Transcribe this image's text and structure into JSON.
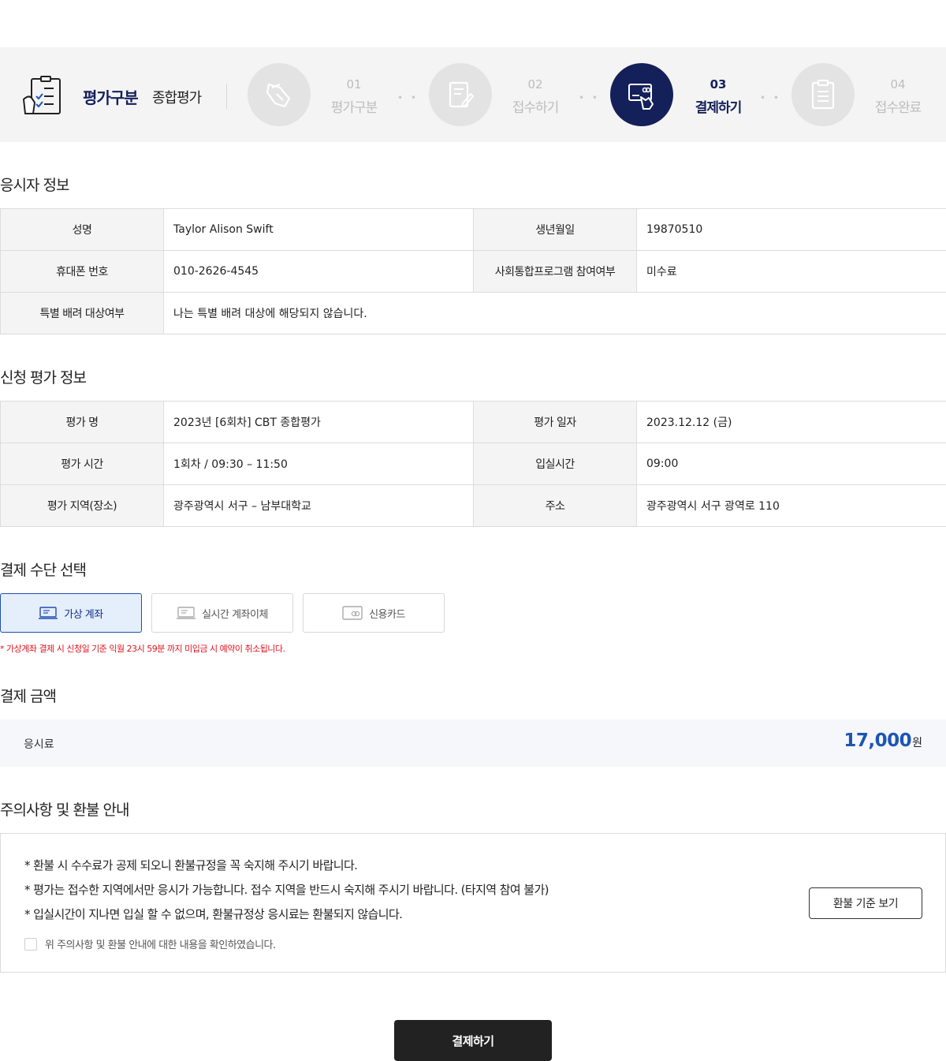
{
  "category": {
    "label": "평가구분",
    "value": "종합평가"
  },
  "steps": [
    {
      "num": "01",
      "title": "평가구분"
    },
    {
      "num": "02",
      "title": "접수하기"
    },
    {
      "num": "03",
      "title": "결제하기"
    },
    {
      "num": "04",
      "title": "접수완료"
    }
  ],
  "active_step": "03",
  "applicant": {
    "title": "응시자 정보",
    "name_label": "성명",
    "name_value": "Taylor Alison Swift",
    "birth_label": "생년월일",
    "birth_value": "19870510",
    "phone_label": "휴대폰 번호",
    "phone_value": "010-2626-4545",
    "program_label": "사회통합프로그램 참여여부",
    "program_value": "미수료",
    "special_label": "특별 배려 대상여부",
    "special_value": "나는 특별 배려 대상에 해당되지 않습니다."
  },
  "exam": {
    "title": "신청 평가 정보",
    "name_label": "평가 명",
    "name_value": "2023년 [6회차] CBT 종합평가",
    "date_label": "평가 일자",
    "date_value": "2023.12.12 (금)",
    "time_label": "평가 시간",
    "time_value": "1회차 / 09:30 – 11:50",
    "entry_label": "입실시간",
    "entry_value": "09:00",
    "region_label": "평가 지역(장소)",
    "region_value": "광주광역시 서구 – 남부대학교",
    "address_label": "주소",
    "address_value": "광주광역시 서구 광역로 110"
  },
  "payment": {
    "title": "결제 수단 선택",
    "methods": [
      {
        "label": "가상 계좌",
        "selected": true
      },
      {
        "label": "실시간 계좌이체",
        "selected": false
      },
      {
        "label": "신용카드",
        "selected": false
      }
    ],
    "note": "* 가상계좌 결제 시 신청일 기준 익월 23시 59분 까지 미입금 시 예약이 취소됩니다."
  },
  "amount": {
    "title": "결제 금액",
    "label": "응시료",
    "value": "17,000",
    "unit": "원"
  },
  "notice": {
    "title": "주의사항 및 환불 안내",
    "lines": [
      "* 환불 시 수수료가 공제 되오니 환불규정을 꼭 숙지해 주시기 바랍니다.",
      "* 평가는 접수한 지역에서만 응시가 가능합니다. 접수 지역을 반드시 숙지해 주시기 바랍니다. (타지역 참여 불가)",
      "* 입실시간이 지나면 입실 할 수 없으며, 환불규정상 응시료는 환불되지 않습니다."
    ],
    "agree_label": "위 주의사항 및 환불 안내에 대한 내용을 확인하였습니다.",
    "agree_checked": false,
    "refund_button": "환불 기준 보기"
  },
  "submit_label": "결제하기",
  "colors": {
    "navy": "#14205a",
    "accent_blue": "#1e55b4",
    "warning_red": "#e0141e",
    "submit_bg": "#222222"
  }
}
